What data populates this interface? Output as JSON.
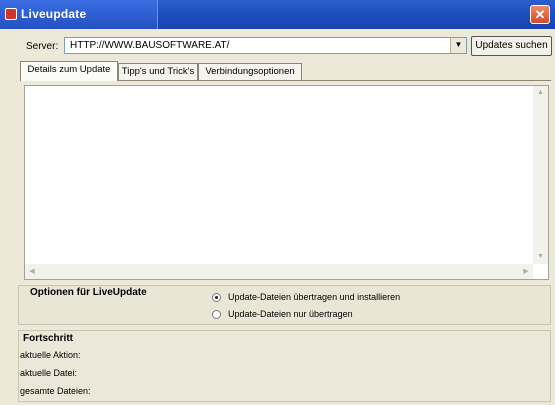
{
  "window": {
    "title": "Liveupdate",
    "close_glyph": "✕"
  },
  "server": {
    "label": "Server:",
    "value": "HTTP://WWW.BAUSOFTWARE.AT/",
    "dropdown_glyph": "▼",
    "search_button": "Updates suchen"
  },
  "tabs": [
    {
      "label": "Details zum Update",
      "active": true
    },
    {
      "label": "Tipp's und Trick's",
      "active": false
    },
    {
      "label": "Verbindungsoptionen",
      "active": false
    }
  ],
  "scrollbars": {
    "up": "▲",
    "down": "▼",
    "left": "◀",
    "right": "▶"
  },
  "options": {
    "title": "Optionen für LiveUpdate",
    "radios": [
      {
        "label": "Update-Dateien übertragen und installieren",
        "checked": true
      },
      {
        "label": "Update-Dateien nur übertragen",
        "checked": false
      }
    ]
  },
  "progress": {
    "title": "Fortschritt",
    "current_action_label": "aktuelle Aktion:",
    "current_file_label": "aktuelle Datei:",
    "all_files_label": "gesamte Dateien:"
  },
  "icons": {
    "app": "liveupdate-app-icon",
    "close": "close-icon"
  }
}
